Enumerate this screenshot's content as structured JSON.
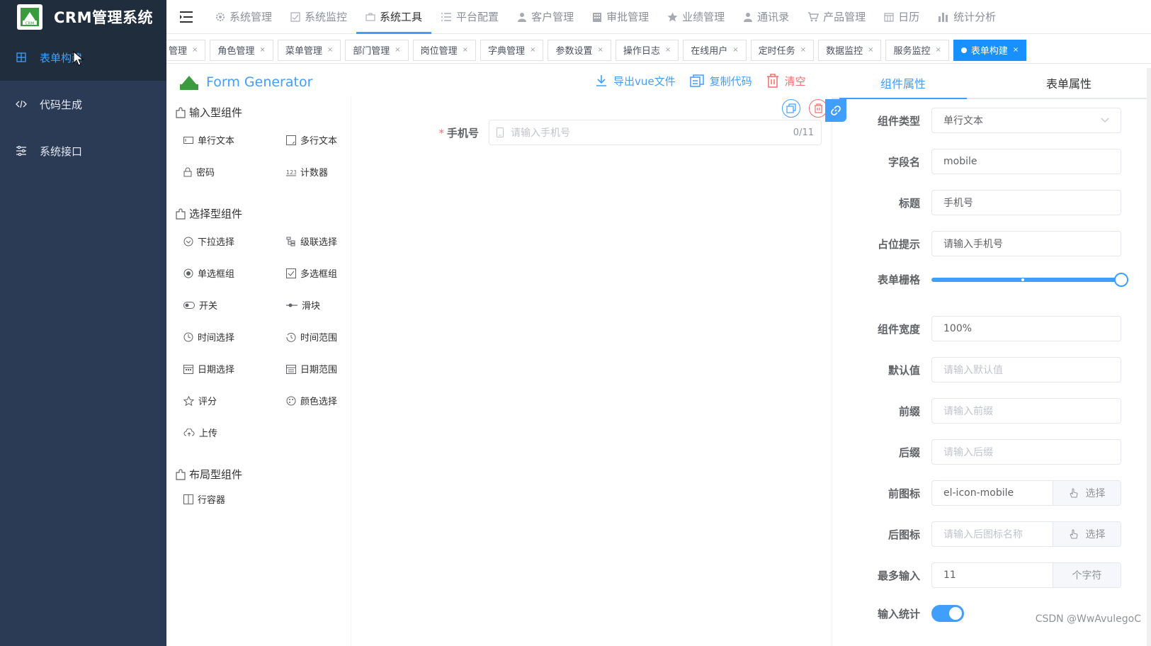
{
  "brand": {
    "title": "CRM管理系统",
    "logo_text": "CRM"
  },
  "sidebar": {
    "items": [
      {
        "label": "表单构建",
        "icon": "grid-icon",
        "active": true
      },
      {
        "label": "代码生成",
        "icon": "code-icon",
        "active": false
      },
      {
        "label": "系统接口",
        "icon": "sliders-icon",
        "active": false
      }
    ]
  },
  "topnav": {
    "items": [
      {
        "label": "系统管理",
        "icon": "gear-icon"
      },
      {
        "label": "系统监控",
        "icon": "monitor-icon"
      },
      {
        "label": "系统工具",
        "icon": "toolbox-icon",
        "active": true
      },
      {
        "label": "平台配置",
        "icon": "list-icon"
      },
      {
        "label": "客户管理",
        "icon": "user-icon"
      },
      {
        "label": "审批管理",
        "icon": "building-icon"
      },
      {
        "label": "业绩管理",
        "icon": "star-icon"
      },
      {
        "label": "通讯录",
        "icon": "user-icon"
      },
      {
        "label": "产品管理",
        "icon": "cart-icon"
      },
      {
        "label": "日历",
        "icon": "calendar-icon"
      },
      {
        "label": "统计分析",
        "icon": "bar-chart-icon"
      }
    ]
  },
  "tabs": [
    {
      "label": "管理"
    },
    {
      "label": "角色管理"
    },
    {
      "label": "菜单管理"
    },
    {
      "label": "部门管理"
    },
    {
      "label": "岗位管理"
    },
    {
      "label": "字典管理"
    },
    {
      "label": "参数设置"
    },
    {
      "label": "操作日志"
    },
    {
      "label": "在线用户"
    },
    {
      "label": "定时任务"
    },
    {
      "label": "数据监控"
    },
    {
      "label": "服务监控"
    },
    {
      "label": "表单构建",
      "active": true
    }
  ],
  "tab_close": "×",
  "generator": {
    "title": "Form Generator",
    "groups": [
      {
        "title": "输入型组件",
        "items": [
          {
            "label": "单行文本",
            "icon": "input-icon"
          },
          {
            "label": "多行文本",
            "icon": "textarea-icon"
          },
          {
            "label": "密码",
            "icon": "lock-icon"
          },
          {
            "label": "计数器",
            "icon": "number-icon"
          }
        ]
      },
      {
        "title": "选择型组件",
        "items": [
          {
            "label": "下拉选择",
            "icon": "select-icon"
          },
          {
            "label": "级联选择",
            "icon": "cascader-icon"
          },
          {
            "label": "单选框组",
            "icon": "radio-icon"
          },
          {
            "label": "多选框组",
            "icon": "checkbox-icon"
          },
          {
            "label": "开关",
            "icon": "switch-icon"
          },
          {
            "label": "滑块",
            "icon": "slider-icon"
          },
          {
            "label": "时间选择",
            "icon": "clock-icon"
          },
          {
            "label": "时间范围",
            "icon": "time-range-icon"
          },
          {
            "label": "日期选择",
            "icon": "date-icon"
          },
          {
            "label": "日期范围",
            "icon": "date-range-icon"
          },
          {
            "label": "评分",
            "icon": "star-outline-icon"
          },
          {
            "label": "颜色选择",
            "icon": "palette-icon"
          },
          {
            "label": "上传",
            "icon": "upload-icon"
          }
        ]
      },
      {
        "title": "布局型组件",
        "items": [
          {
            "label": "行容器",
            "icon": "row-icon"
          }
        ]
      }
    ]
  },
  "toolbar": {
    "export_label": "导出vue文件",
    "copy_label": "复制代码",
    "clear_label": "清空"
  },
  "canvas": {
    "field": {
      "label": "手机号",
      "required_mark": "*",
      "placeholder": "请输入手机号",
      "count": "0/11"
    }
  },
  "props": {
    "tabs": [
      {
        "label": "组件属性",
        "active": true
      },
      {
        "label": "表单属性"
      }
    ],
    "rows": {
      "type": {
        "label": "组件类型",
        "value": "单行文本"
      },
      "field": {
        "label": "字段名",
        "value": "mobile"
      },
      "title": {
        "label": "标题",
        "value": "手机号"
      },
      "placeholder": {
        "label": "占位提示",
        "value": "请输入手机号"
      },
      "span": {
        "label": "表单栅格",
        "value": 24,
        "max": 24
      },
      "width": {
        "label": "组件宽度",
        "value": "100%"
      },
      "default": {
        "label": "默认值",
        "placeholder": "请输入默认值"
      },
      "prefix": {
        "label": "前缀",
        "placeholder": "请输入前缀"
      },
      "suffix": {
        "label": "后缀",
        "placeholder": "请输入后缀"
      },
      "prefix_icon": {
        "label": "前图标",
        "value": "el-icon-mobile",
        "button": "选择"
      },
      "suffix_icon": {
        "label": "后图标",
        "placeholder": "请输入后图标名称",
        "button": "选择"
      },
      "maxlength": {
        "label": "最多输入",
        "value": "11",
        "append": "个字符"
      },
      "show_count": {
        "label": "输入统计",
        "value": true
      }
    }
  },
  "watermark": "CSDN @WwAvulegoC",
  "colors": {
    "accent": "#409eff",
    "sidebar": "#2b3a55",
    "danger": "#f56c6c"
  }
}
